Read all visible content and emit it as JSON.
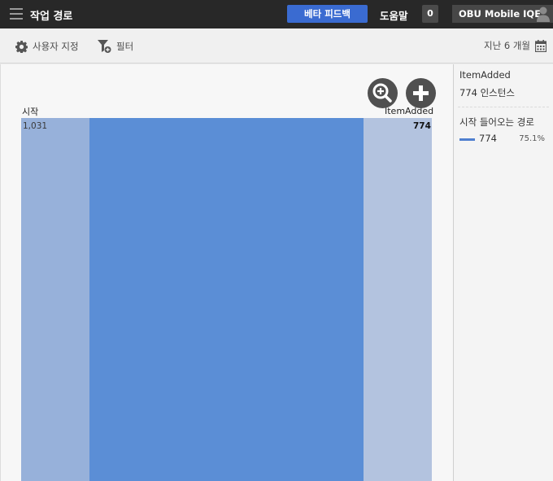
{
  "header": {
    "title": "작업 경로",
    "beta_feedback_label": "베타 피드백",
    "help_label": "도움말",
    "notification_count": "0",
    "account_name": "OBU Mobile IQE"
  },
  "toolbar": {
    "customize_label": "사용자 지정",
    "filter_label": "필터",
    "date_range_label": "지난 6 개월"
  },
  "chart_data": {
    "type": "sankey",
    "nodes": [
      {
        "name": "시작",
        "value": 1031,
        "value_label": "1,031"
      },
      {
        "name": "ItemAdded",
        "value": 774,
        "value_label": "774"
      }
    ],
    "links": [
      {
        "source": "시작",
        "target": "ItemAdded",
        "value": 774
      }
    ],
    "colors": {
      "start_node": "#97b1da",
      "flow": "#5b8ed6",
      "end_node": "#b3c3df"
    }
  },
  "side_panel": {
    "node_name": "ItemAdded",
    "instances_label": "774 인스턴스",
    "section_title": "시작 들어오는 경로",
    "rows": [
      {
        "count": "774",
        "percent": "75.1%",
        "color": "#4f7fcf"
      }
    ]
  }
}
